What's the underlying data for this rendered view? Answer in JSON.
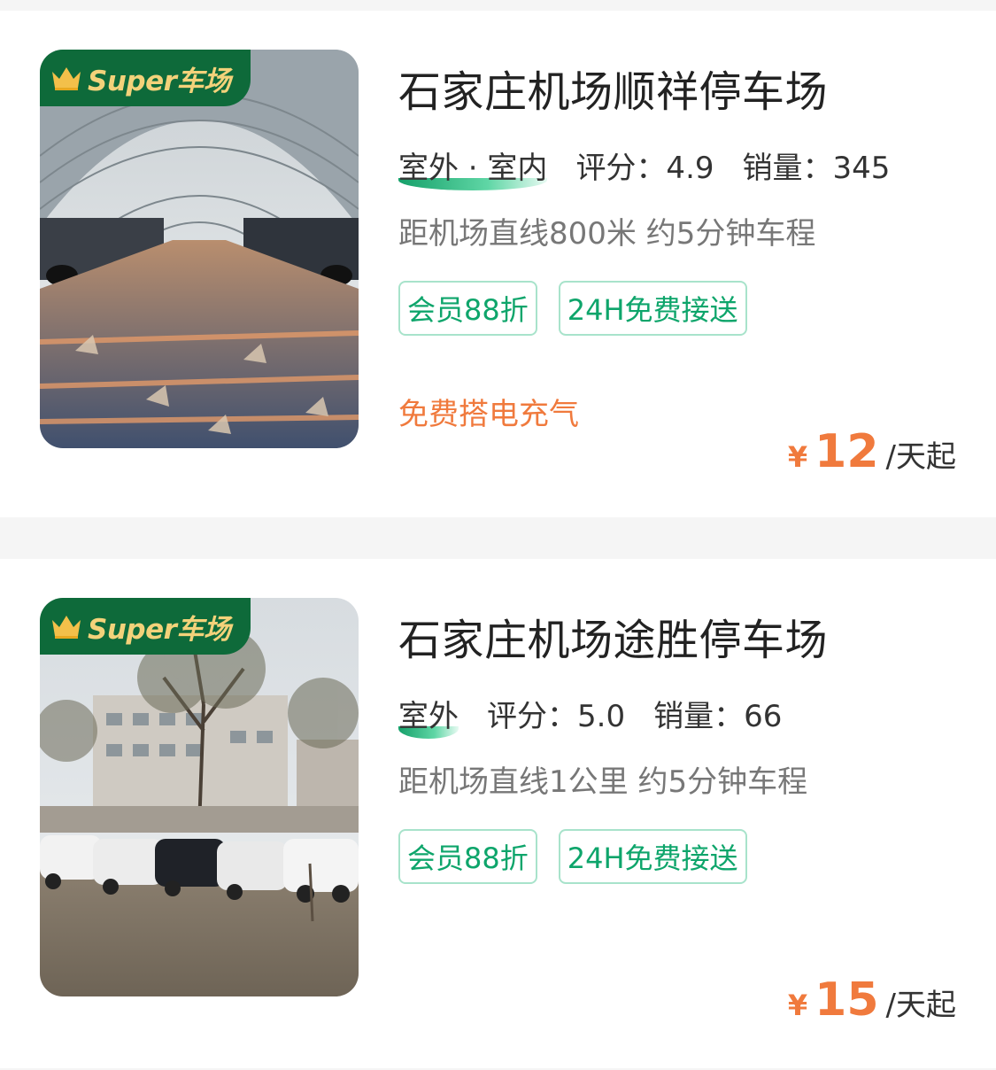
{
  "lots": [
    {
      "badge": "Super车场",
      "title": "石家庄机场顺祥停车场",
      "type": "室外 · 室内",
      "rating": "评分：4.9",
      "sales": "销量：345",
      "distance": "距机场直线800米 约5分钟车程",
      "tags": [
        "会员88折",
        "24H免费接送"
      ],
      "promo": "免费搭电充气",
      "price": {
        "currency": "¥",
        "amount": "12",
        "unit": "/天起"
      }
    },
    {
      "badge": "Super车场",
      "title": "石家庄机场途胜停车场",
      "type": "室外",
      "rating": "评分：5.0",
      "sales": "销量：66",
      "distance": "距机场直线1公里 约5分钟车程",
      "tags": [
        "会员88折",
        "24H免费接送"
      ],
      "promo": "",
      "price": {
        "currency": "¥",
        "amount": "15",
        "unit": "/天起"
      }
    }
  ],
  "colors": {
    "badge_bg": "#0e6a3a",
    "badge_text": "#f3d27a",
    "tag_green": "#0ea56b",
    "price_orange": "#f07a3d"
  }
}
